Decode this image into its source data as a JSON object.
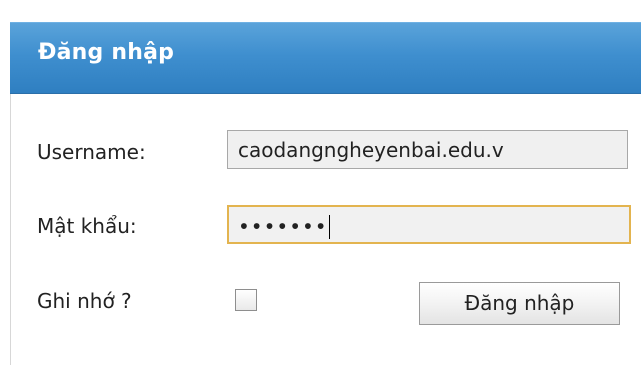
{
  "login_panel": {
    "title": "Đăng nhập",
    "username_label": "Username:",
    "username_value": "caodangngheyenbai.edu.v",
    "password_label": "Mật khẩu:",
    "password_mask": "•••••••",
    "remember_label": "Ghi nhớ ?",
    "remember_checked": false,
    "submit_label": "Đăng nhập"
  },
  "colors": {
    "header_blue": "#3f8fcf",
    "focus_border": "#e3b44f",
    "field_background": "#f0f0f0"
  }
}
